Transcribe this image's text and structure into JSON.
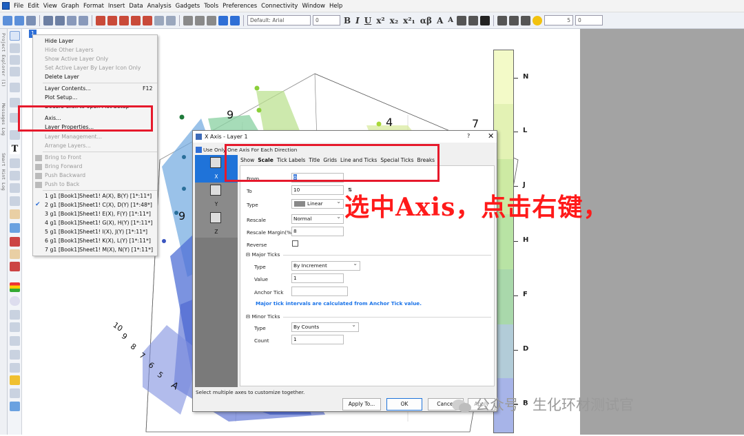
{
  "menubar": {
    "items": [
      "File",
      "Edit",
      "View",
      "Graph",
      "Format",
      "Insert",
      "Data",
      "Analysis",
      "Gadgets",
      "Tools",
      "Preferences",
      "Connectivity",
      "Window",
      "Help"
    ]
  },
  "toolbar": {
    "font_family": "Default: Arial",
    "font_size": "0",
    "fmt_buttons": [
      "B",
      "I",
      "U",
      "x²",
      "x₂",
      "x²₁",
      "αβ",
      "A",
      "A"
    ],
    "line_width": "5",
    "line_size": "0"
  },
  "left_strip": {
    "labels": [
      "Project Explorer (1)",
      "Messages Log",
      "Smart Hint Log"
    ]
  },
  "layer_tag": "1",
  "context_menu": {
    "items": [
      {
        "label": "Hide Layer",
        "disabled": false
      },
      {
        "label": "Hide Other Layers",
        "disabled": true
      },
      {
        "label": "Show Active Layer Only",
        "disabled": true
      },
      {
        "label": "Set Active Layer By Layer Icon Only",
        "disabled": true
      },
      {
        "label": "Delete Layer",
        "disabled": false
      },
      {
        "label": "Layer Contents...",
        "disabled": false,
        "shortcut": "F12"
      },
      {
        "label": "Plot Setup...",
        "disabled": false
      },
      {
        "label": "Double-click to open Plot Setup",
        "disabled": false
      },
      {
        "label": "Axis...",
        "disabled": false
      },
      {
        "label": "Layer Properties...",
        "disabled": false
      },
      {
        "label": "Layer Management...",
        "disabled": true
      },
      {
        "label": "Arrange Layers...",
        "disabled": true
      },
      {
        "label": "Bring to Front",
        "disabled": true
      },
      {
        "label": "Bring Forward",
        "disabled": true
      },
      {
        "label": "Push Backward",
        "disabled": true
      },
      {
        "label": "Push to Back",
        "disabled": true
      },
      {
        "label": "1 g1 [Book1]Sheet1! A(X), B(Y) [1*:11*]",
        "disabled": false
      },
      {
        "label": "2 g1 [Book1]Sheet1! C(X), D(Y) [1*:48*]",
        "disabled": false,
        "checked": true
      },
      {
        "label": "3 g1 [Book1]Sheet1! E(X), F(Y) [1*:11*]",
        "disabled": false
      },
      {
        "label": "4 g1 [Book1]Sheet1! G(X), H(Y) [1*:11*]",
        "disabled": false
      },
      {
        "label": "5 g1 [Book1]Sheet1! I(X), J(Y) [1*:11*]",
        "disabled": false
      },
      {
        "label": "6 g1 [Book1]Sheet1! K(X), L(Y) [1*:11*]",
        "disabled": false
      },
      {
        "label": "7 g1 [Book1]Sheet1! M(X), N(Y) [1*:11*]",
        "disabled": false
      }
    ]
  },
  "dialog": {
    "title": "X Axis - Layer 1",
    "help": "?",
    "close": "✕",
    "use_one_axis_label": "Use Only One Axis For Each Direction",
    "axes": [
      "X",
      "Y",
      "Z"
    ],
    "tabs": [
      "Show",
      "Scale",
      "Tick Labels",
      "Title",
      "Grids",
      "Line and Ticks",
      "Special Ticks",
      "Breaks"
    ],
    "active_tab": "Scale",
    "scale": {
      "from_label": "From",
      "from_value": "0",
      "to_label": "To",
      "to_value": "10",
      "type_label": "Type",
      "type_value": "Linear",
      "rescale_label": "Rescale",
      "rescale_value": "Normal",
      "rescale_margin_label": "Rescale Margin(%)",
      "rescale_margin_value": "8",
      "reverse_label": "Reverse"
    },
    "major": {
      "section": "Major Ticks",
      "type_label": "Type",
      "type_value": "By Increment",
      "value_label": "Value",
      "value_value": "1",
      "anchor_label": "Anchor Tick",
      "anchor_value": "",
      "note": "Major tick intervals are calculated from Anchor Tick value."
    },
    "minor": {
      "section": "Minor Ticks",
      "type_label": "Type",
      "type_value": "By Counts",
      "count_label": "Count",
      "count_value": "1"
    },
    "status": "Select multiple axes to customize together.",
    "buttons": {
      "apply_to": "Apply To...",
      "ok": "OK",
      "cancel": "Cancel",
      "apply": "Apply"
    }
  },
  "annotation": "选中Axis，点击右键，",
  "colorbar": {
    "labels": [
      "N",
      "L",
      "J",
      "H",
      "F",
      "D",
      "B"
    ],
    "colors": [
      "#f3fac8",
      "#e3f2b4",
      "#cdeaa3",
      "#b8e3a4",
      "#a9d8ab",
      "#b2ccd8",
      "#a7b4e8"
    ]
  },
  "plot": {
    "labels": [
      "9",
      "9",
      "4",
      "7",
      "10",
      "9",
      "8",
      "7",
      "6",
      "5",
      "A"
    ]
  },
  "watermark": "公众号 · 生化环材测试官"
}
